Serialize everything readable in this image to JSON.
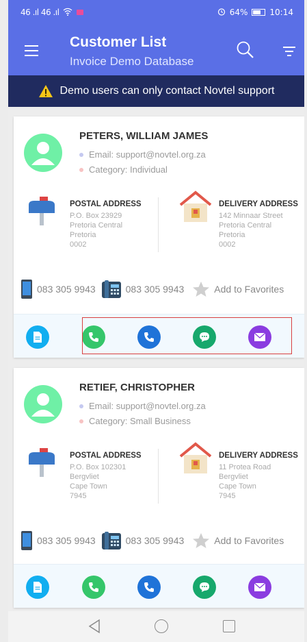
{
  "status_bar": {
    "signal_left": "46 .ıl 46 .ıl",
    "battery_text": "64%",
    "time": "10:14",
    "icons": [
      "signal-icon",
      "wifi-icon",
      "alarm-icon",
      "battery-icon"
    ]
  },
  "app_bar": {
    "title": "Customer List",
    "subtitle": "Invoice Demo Database",
    "icons": [
      "hamburger-icon",
      "search-icon",
      "filter-icon"
    ]
  },
  "banner": {
    "text": "Demo users can only contact Novtel support",
    "icon": "warning-icon"
  },
  "customers": [
    {
      "name": "PETERS, WILLIAM JAMES",
      "email": "Email: support@novtel.org.za",
      "category": "Category: Individual",
      "postal": {
        "title": "POSTAL ADDRESS",
        "lines": [
          "P.O. Box 23929",
          "Pretoria Central",
          "Pretoria",
          "0002"
        ]
      },
      "delivery": {
        "title": "DELIVERY ADDRESS",
        "lines": [
          "142 Minnaar Street",
          "Pretoria Central",
          "Pretoria",
          "0002"
        ]
      },
      "mobile": "083 305 9943",
      "landline": "083 305 9943",
      "favorite_label": "Add to Favorites"
    },
    {
      "name": "RETIEF, CHRISTOPHER",
      "email": "Email: support@novtel.org.za",
      "category": "Category: Small Business",
      "postal": {
        "title": "POSTAL ADDRESS",
        "lines": [
          "P.O. Box 102301",
          "Bergvliet",
          "Cape Town",
          "7945"
        ]
      },
      "delivery": {
        "title": "DELIVERY ADDRESS",
        "lines": [
          "11 Protea Road",
          "Bergvliet",
          "Cape Town",
          "7945"
        ]
      },
      "mobile": "083 305 9943",
      "landline": "083 305 9943",
      "favorite_label": "Add to Favorites"
    }
  ],
  "colors": {
    "primary": "#5a6fe6",
    "banner": "#202b5f",
    "avatar": "#6ff0a6",
    "doc_action": "#12aef0",
    "call_action": "#35c66a",
    "phone_action": "#1f73d8",
    "sms_action": "#17a86c",
    "mail_action": "#8a3ce0",
    "highlight": "#d94040"
  }
}
